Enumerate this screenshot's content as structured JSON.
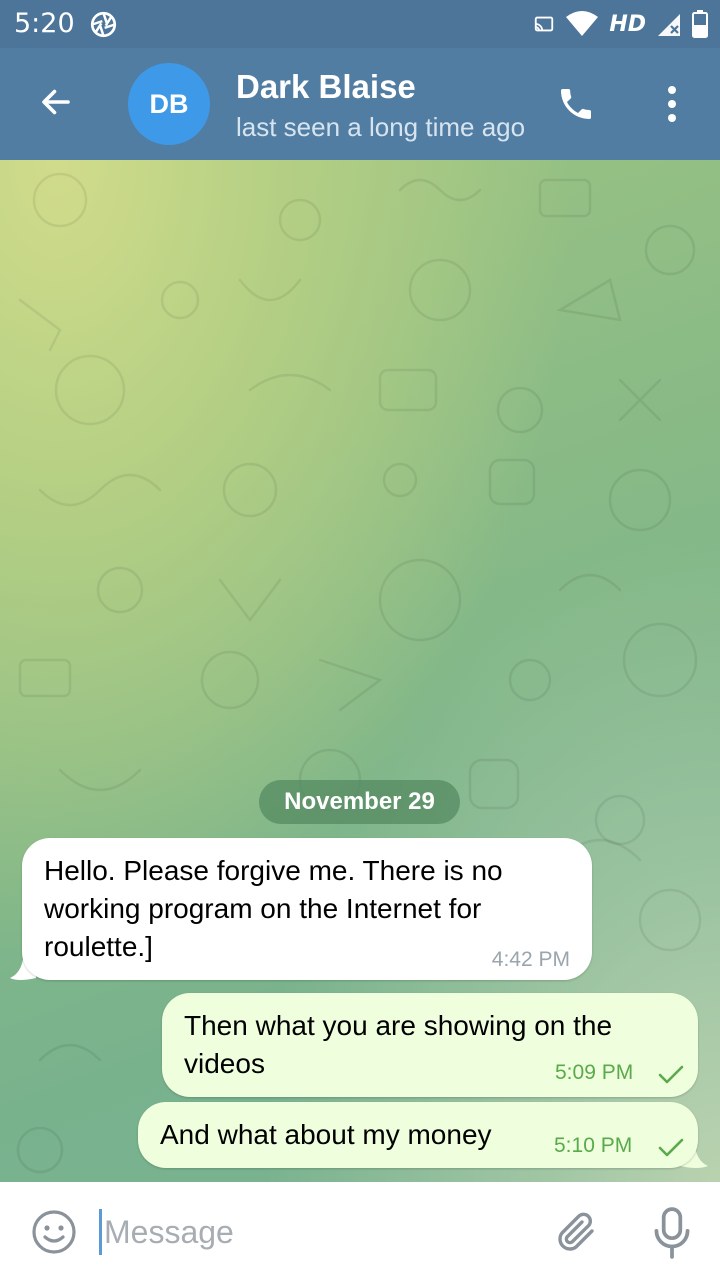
{
  "status_bar": {
    "time": "5:20",
    "network_label": "HD",
    "icons": [
      "aperture-icon",
      "cast-icon",
      "wifi-icon",
      "signal-icon",
      "battery-icon"
    ]
  },
  "header": {
    "avatar_initials": "DB",
    "contact_name": "Dark Blaise",
    "status_text": "last seen a long time ago",
    "icons": [
      "back-arrow-icon",
      "phone-icon",
      "more-vertical-icon"
    ]
  },
  "chat": {
    "date_separator": "November 29",
    "messages": [
      {
        "direction": "incoming",
        "text": "Hello. Please forgive me. There is no\nworking program on the Internet for\nroulette.]",
        "time": "4:42 PM"
      },
      {
        "direction": "outgoing",
        "text": "Then what you are showing on the\nvideos",
        "time": "5:09 PM",
        "status": "sent"
      },
      {
        "direction": "outgoing",
        "text": "And what about my money",
        "time": "5:10 PM",
        "status": "sent"
      }
    ]
  },
  "composer": {
    "placeholder": "Message",
    "value": "",
    "icons": [
      "emoji-icon",
      "attach-icon",
      "microphone-icon"
    ]
  },
  "colors": {
    "header_bg": "#527da3",
    "status_bar_bg": "#4c7599",
    "avatar_bg": "#3e9ae8",
    "outgoing_bubble": "#effedd",
    "incoming_bubble": "#ffffff",
    "outgoing_time": "#5aaa4c"
  }
}
